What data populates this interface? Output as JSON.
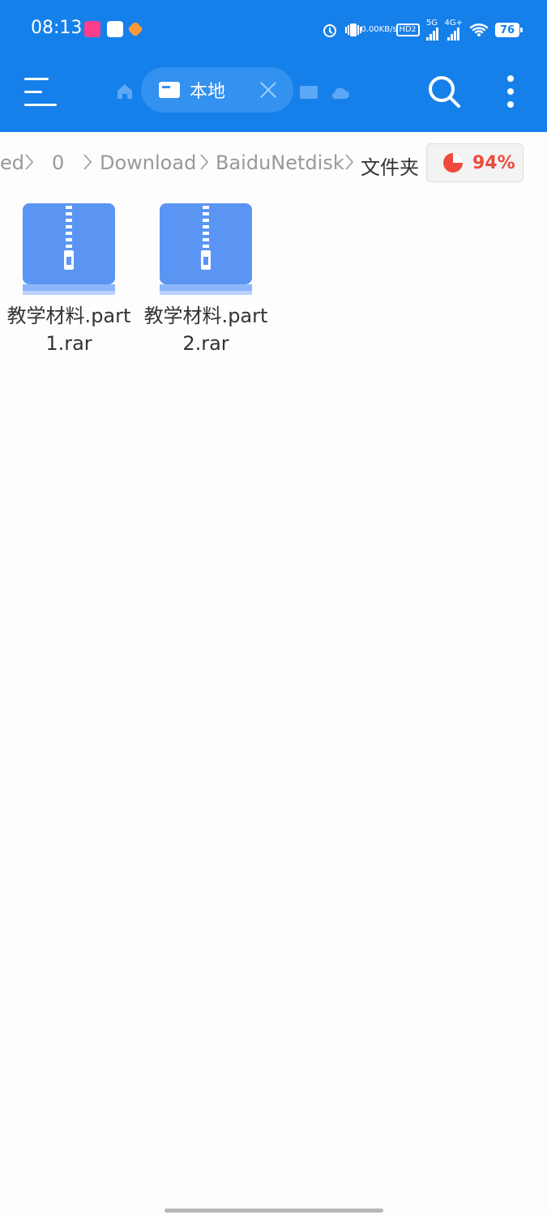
{
  "status_bar": {
    "time": "08:13",
    "net_speed_top": "0.00",
    "net_speed_unit": "KB/s",
    "network_5g": "5G",
    "network_4g": "4G+",
    "hd": "HD",
    "sim2": "2",
    "battery": "76",
    "icons": [
      "app-pink-icon",
      "app-card-icon",
      "app-heart-icon",
      "alarm-icon",
      "vibrate-icon",
      "wifi-icon"
    ]
  },
  "app_bar": {
    "tab_label": "本地",
    "icons": [
      "menu-icon",
      "home-icon",
      "local-storage-icon",
      "close-icon",
      "drive-icon",
      "cloud-icon",
      "search-icon",
      "more-vertical-icon"
    ],
    "accent_color": "#1680ea"
  },
  "breadcrumb": {
    "items": [
      "ed",
      "0",
      "Download",
      "BaiduNetdisk",
      "文件夹"
    ]
  },
  "storage": {
    "percent_text": "94%",
    "percent_value": 94,
    "color": "#ef4a3b"
  },
  "files": [
    {
      "name": "教学材料.part1.rar",
      "icon": "zip-file-icon"
    },
    {
      "name": "教学材料.part2.rar",
      "icon": "zip-file-icon"
    }
  ]
}
